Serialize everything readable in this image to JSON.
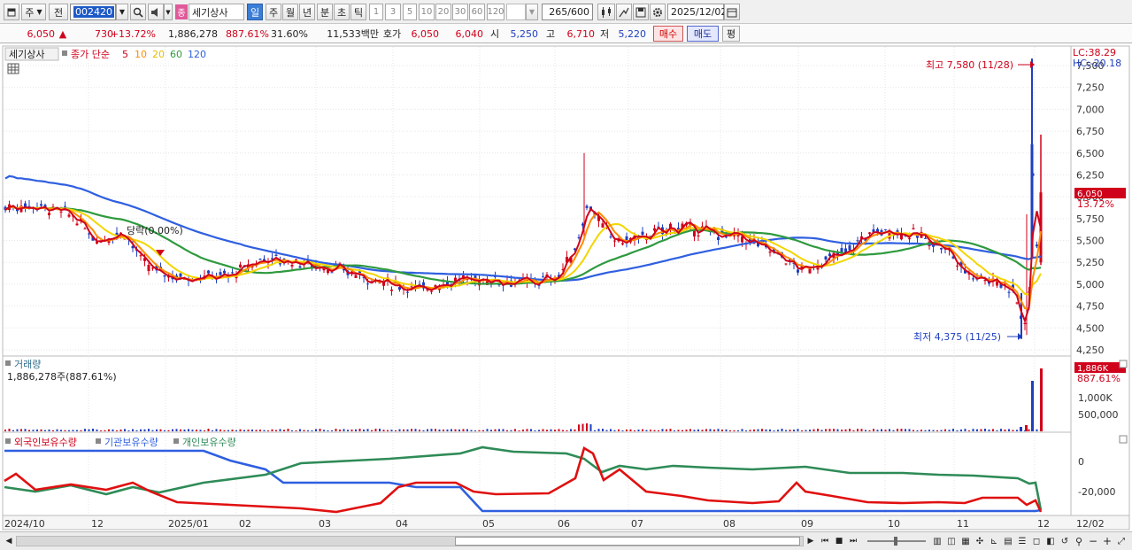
{
  "toolbar": {
    "period_select": "주",
    "prev_label": "전",
    "code_value": "002420",
    "stock_badge": "종",
    "stock_name": "세기상사",
    "periods": [
      "일",
      "주",
      "월",
      "년",
      "분",
      "초",
      "틱"
    ],
    "intervals": [
      "1",
      "3",
      "5",
      "10",
      "20",
      "30",
      "60",
      "120"
    ],
    "count": "265",
    "count_max": "/600",
    "date": "2025/12/02"
  },
  "quote": {
    "price": "6,050",
    "arrow": "▲",
    "change": "730",
    "change_pct": "+13.72%",
    "volume": "1,886,278",
    "volume_ratio": "887.61%",
    "turnover": "31.60%",
    "amount": "11,533백만",
    "bid_label": "호가",
    "ask": "6,050",
    "bid": "6,040",
    "open_label": "시",
    "open": "5,250",
    "high_label": "고",
    "high": "6,710",
    "low_label": "저",
    "low": "5,220",
    "buy_label": "매수",
    "sell_label": "매도",
    "eval_label": "평"
  },
  "price_legend": {
    "name": "세기상사",
    "close_label": "종가 단순",
    "ma": [
      "5",
      "10",
      "20",
      "60",
      "120"
    ]
  },
  "price_pane": {
    "lc": "LC:38.29",
    "hc": "HC:-20.18",
    "yticks": [
      "7,500",
      "7,250",
      "7,000",
      "6,750",
      "6,500",
      "6,250",
      "6,000",
      "5,750",
      "5,500",
      "5,250",
      "5,000",
      "4,750",
      "4,500",
      "4,250"
    ],
    "current_price_tag": "6,050",
    "current_pct": "13.72%",
    "high_annotation": "최고 7,580 (11/28)",
    "low_annotation": "최저 4,375 (11/25)",
    "event_label": "당락(0.00%)"
  },
  "volume_pane": {
    "title": "거래량",
    "value": "1,886,278주(887.61%)",
    "tag": "1,886K",
    "tag_pct": "887.61%",
    "yticks": [
      "1,000K",
      "500,000"
    ]
  },
  "holdings_pane": {
    "legends": [
      "외국인보유수량",
      "기관보유수량",
      "개인보유수량"
    ],
    "yticks": [
      "0",
      "-20,000"
    ]
  },
  "xaxis": {
    "labels": [
      "2024/10",
      "12",
      "2025/01",
      "02",
      "03",
      "04",
      "05",
      "06",
      "07",
      "08",
      "09",
      "10",
      "11",
      "12",
      "12/02"
    ]
  },
  "colors": {
    "up": "#d0021b",
    "down": "#1f3fbf",
    "ma5": "#d0021b",
    "ma10": "#ff8c00",
    "ma20": "#f2d600",
    "ma60": "#2e9a3e",
    "ma120": "#2f5fe0",
    "foreign": "#e01010",
    "inst": "#2f5fe0",
    "indiv": "#2e8b57"
  }
}
